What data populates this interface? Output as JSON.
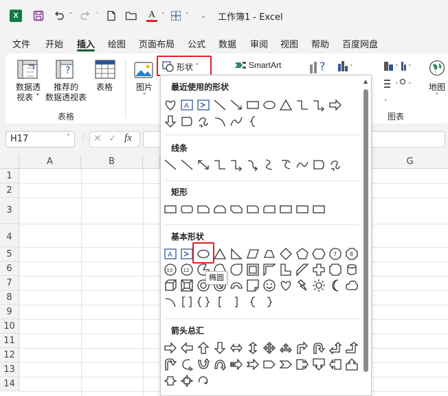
{
  "app": {
    "title": "工作簿1  -  Excel",
    "logo_letter": "X"
  },
  "tabs": [
    {
      "label": "文件"
    },
    {
      "label": "开始"
    },
    {
      "label": "插入"
    },
    {
      "label": "绘图"
    },
    {
      "label": "页面布局"
    },
    {
      "label": "公式"
    },
    {
      "label": "数据"
    },
    {
      "label": "审阅"
    },
    {
      "label": "视图"
    },
    {
      "label": "帮助"
    },
    {
      "label": "百度网盘"
    }
  ],
  "ribbon": {
    "pivot_label_1": "数据透",
    "pivot_label_2": "视表 ˅",
    "recommended_label_1": "推荐的",
    "recommended_label_2": "数据透视表",
    "table_label": "表格",
    "group_tables": "表格",
    "picture_label": "图片",
    "picture_arrow": "˅",
    "shapes_label": "形状",
    "shapes_arrow": "˅",
    "smartart_label": "SmartArt",
    "map_label": "地图",
    "map_arrow": "˅",
    "group_charts": "图表"
  },
  "formula_bar": {
    "name_box": "H17",
    "fx": "fx"
  },
  "columns": [
    "A",
    "B",
    "G"
  ],
  "rows": [
    "1",
    "2",
    "3",
    "4",
    "5",
    "6",
    "7",
    "8",
    "9",
    "10",
    "11",
    "12",
    "13",
    "14"
  ],
  "shapes_panel": {
    "recent_title": "最近使用的形状",
    "lines_title": "线条",
    "rect_title": "矩形",
    "basic_title": "基本形状",
    "arrows_title": "箭头总汇",
    "tooltip": "椭圆"
  },
  "colors": {
    "excel_green": "#107c41",
    "accent_underline": "#185c37",
    "highlight": "#e02020",
    "icon_blue": "#2b5797"
  }
}
